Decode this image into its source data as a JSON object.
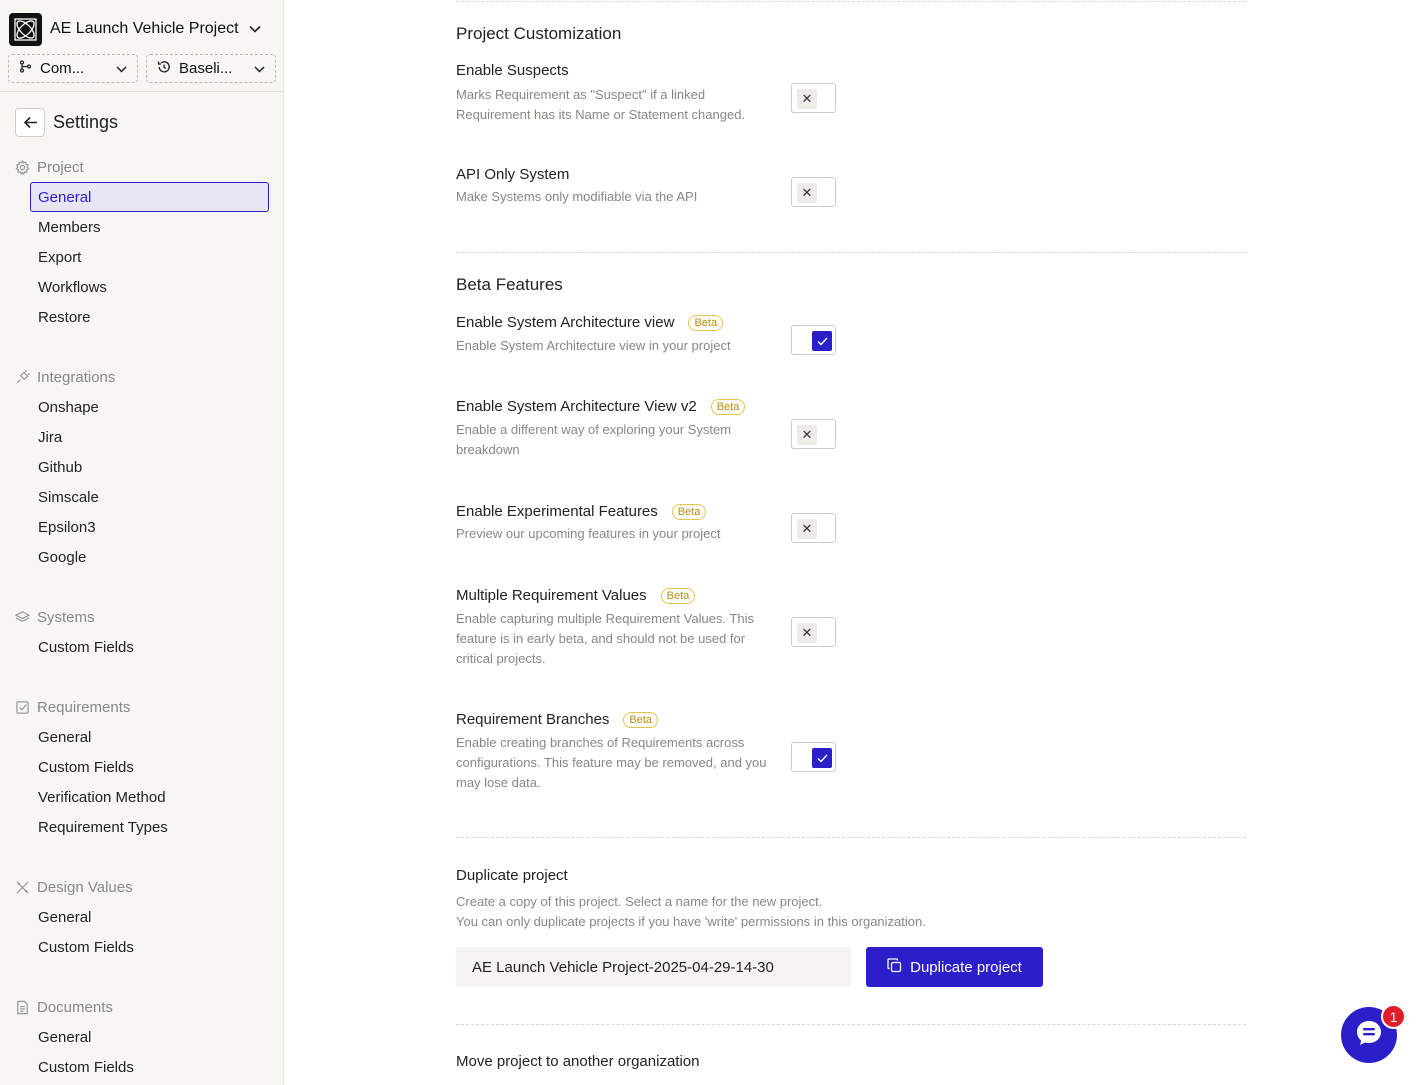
{
  "project": {
    "name": "AE Launch Vehicle Project"
  },
  "selectors": [
    {
      "label": "Com...",
      "icon": "branch-icon"
    },
    {
      "label": "Baseli...",
      "icon": "history-icon"
    }
  ],
  "sidebar": {
    "title": "Settings",
    "sections": {
      "project": {
        "label": "Project",
        "items": [
          "General",
          "Members",
          "Export",
          "Workflows",
          "Restore"
        ]
      },
      "integrations": {
        "label": "Integrations",
        "items": [
          "Onshape",
          "Jira",
          "Github",
          "Simscale",
          "Epsilon3",
          "Google"
        ]
      },
      "systems": {
        "label": "Systems",
        "items": [
          "Custom Fields"
        ]
      },
      "requirements": {
        "label": "Requirements",
        "items": [
          "General",
          "Custom Fields",
          "Verification Method",
          "Requirement Types"
        ]
      },
      "design_values": {
        "label": "Design Values",
        "items": [
          "General",
          "Custom Fields"
        ]
      },
      "documents": {
        "label": "Documents",
        "items": [
          "General",
          "Custom Fields"
        ]
      }
    },
    "active_item": "General"
  },
  "main": {
    "customization": {
      "title": "Project Customization",
      "settings": [
        {
          "title": "Enable Suspects",
          "desc": "Marks Requirement as \"Suspect\" if a linked Requirement has its Name or Statement changed.",
          "enabled": false
        },
        {
          "title": "API Only System",
          "desc": "Make Systems only modifiable via the API",
          "enabled": false
        }
      ]
    },
    "beta": {
      "title": "Beta Features",
      "badge": "Beta",
      "settings": [
        {
          "title": "Enable System Architecture view",
          "desc": "Enable System Architecture view in your project",
          "enabled": true
        },
        {
          "title": "Enable System Architecture View v2",
          "desc": "Enable a different way of exploring your System breakdown",
          "enabled": false
        },
        {
          "title": "Enable Experimental Features",
          "desc": "Preview our upcoming features in your project",
          "enabled": false
        },
        {
          "title": "Multiple Requirement Values",
          "desc": "Enable capturing multiple Requirement Values. This feature is in early beta, and should not be used for critical projects.",
          "enabled": false
        },
        {
          "title": "Requirement Branches",
          "desc": "Enable creating branches of Requirements across configurations. This feature may be removed, and you may lose data.",
          "enabled": true
        }
      ]
    },
    "duplicate": {
      "title": "Duplicate project",
      "desc_line1": "Create a copy of this project. Select a name for the new project.",
      "desc_line2": "You can only duplicate projects if you have 'write' permissions in this organization.",
      "input_value": "AE Launch Vehicle Project-2025-04-29-14-30",
      "button_label": "Duplicate project"
    },
    "move": {
      "title": "Move project to another organization"
    }
  },
  "chat": {
    "badge_count": "1"
  },
  "colors": {
    "accent": "#2a1fc9",
    "beta": "#b98c10",
    "badge": "#e11d2a"
  }
}
